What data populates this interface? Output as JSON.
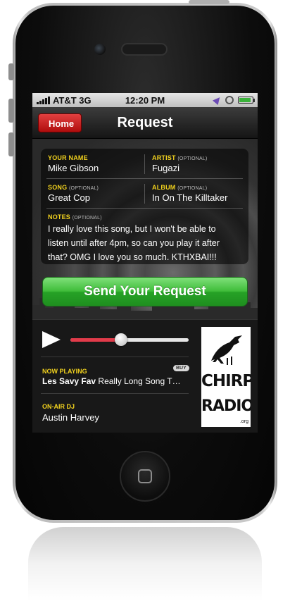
{
  "status_bar": {
    "carrier": "AT&T 3G",
    "time": "12:20 PM"
  },
  "nav": {
    "back_label": "Home",
    "title": "Request"
  },
  "form": {
    "name": {
      "label": "YOUR NAME",
      "value": "Mike Gibson"
    },
    "artist": {
      "label": "ARTIST",
      "optional": "(OPTIONAL)",
      "value": "Fugazi"
    },
    "song": {
      "label": "SONG",
      "optional": "(OPTIONAL)",
      "value": "Great Cop"
    },
    "album": {
      "label": "ALBUM",
      "optional": "(OPTIONAL)",
      "value": "In On The Killtaker"
    },
    "notes": {
      "label": "NOTES",
      "optional": "(OPTIONAL)",
      "value": "I really love this song, but I won't be able to listen until after 4pm, so can you play it after that? OMG I love you so much. KTHXBAI!!!"
    }
  },
  "send_button": {
    "label": "Send Your Request"
  },
  "player": {
    "progress": 0.43,
    "now_playing_label": "NOW PLAYING",
    "buy_label": "BUY",
    "artist": "Les Savy Fav",
    "track": "Really Long Song T…",
    "dj_label": "ON-AIR DJ",
    "dj_name": "Austin Harvey"
  },
  "logo": {
    "line1": "CHIRP",
    "line2": "RADIO",
    "suffix": ".org"
  },
  "colors": {
    "accent_yellow": "#f2d21e",
    "send_green": "#3fbd3a",
    "back_red": "#d02020",
    "progress_red": "#e23b4a"
  },
  "icons": [
    "signal-bars-icon",
    "location-arrow-icon",
    "rotation-lock-icon",
    "battery-icon",
    "play-icon",
    "crow-icon",
    "home-button-icon"
  ]
}
